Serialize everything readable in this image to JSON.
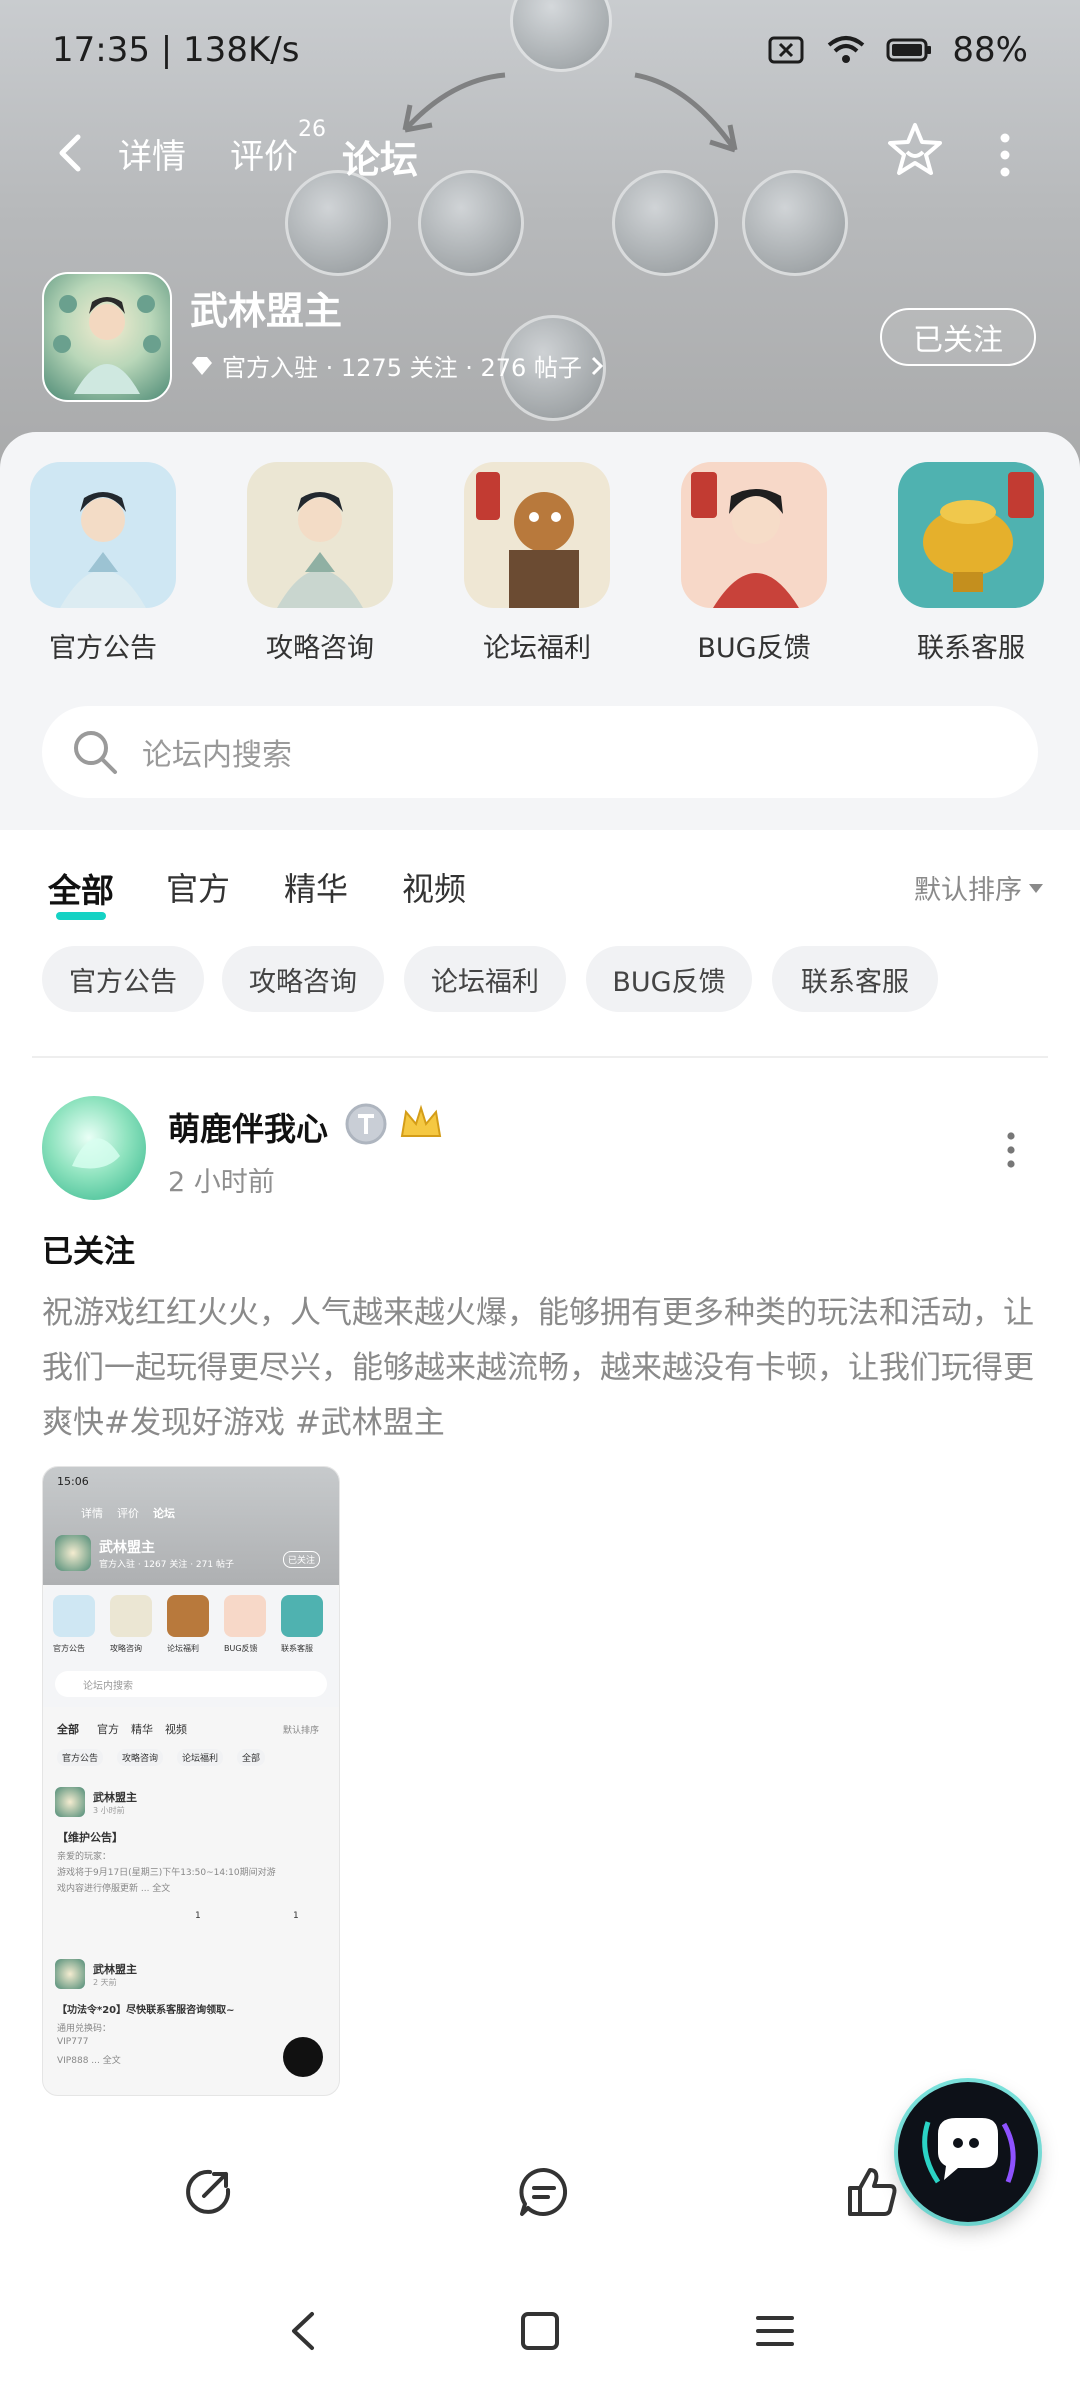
{
  "status_bar": {
    "time_speed": "17:35 | 138K/s",
    "battery": "88%"
  },
  "nav": {
    "tabs": [
      {
        "label": "详情"
      },
      {
        "label": "评价",
        "badge": "26"
      },
      {
        "label": "论坛"
      }
    ],
    "active_tab": "论坛"
  },
  "game": {
    "title": "武林盟主",
    "meta": "官方入驻 · 1275 关注 · 276 帖子",
    "follow_label": "已关注"
  },
  "categories": [
    {
      "label": "官方公告"
    },
    {
      "label": "攻略咨询"
    },
    {
      "label": "论坛福利"
    },
    {
      "label": "BUG反馈"
    },
    {
      "label": "联系客服"
    }
  ],
  "search": {
    "placeholder": "论坛内搜索"
  },
  "filter_tabs": [
    {
      "label": "全部"
    },
    {
      "label": "官方"
    },
    {
      "label": "精华"
    },
    {
      "label": "视频"
    }
  ],
  "sort_label": "默认排序",
  "chips": [
    {
      "label": "官方公告"
    },
    {
      "label": "攻略咨询"
    },
    {
      "label": "论坛福利"
    },
    {
      "label": "BUG反馈"
    },
    {
      "label": "联系客服"
    }
  ],
  "post": {
    "username": "萌鹿伴我心",
    "time": "2 小时前",
    "title": "已关注",
    "body": "祝游戏红红火火，人气越来越火爆，能够拥有更多种类的玩法和活动，让我们一起玩得更尽兴，能够越来越流畅，越来越没有卡顿，让我们玩得更爽快#发现好游戏 #武林盟主",
    "thumbnail": {
      "status_time": "15:06",
      "tabs": [
        "详情",
        "评价",
        "论坛"
      ],
      "game_title": "武林盟主",
      "meta": "官方入驻 · 1267 关注 · 271 帖子",
      "follow": "已关注",
      "categories": [
        "官方公告",
        "攻略咨询",
        "论坛福利",
        "BUG反馈",
        "联系客服"
      ],
      "search": "论坛内搜索",
      "filters": [
        "全部",
        "官方",
        "精华",
        "视频"
      ],
      "sort": "默认排序",
      "chips": [
        "官方公告",
        "攻略咨询",
        "论坛福利",
        "全部"
      ],
      "post1": {
        "author": "武林盟主",
        "time": "3 小时前",
        "title": "【维护公告】",
        "line1": "亲爱的玩家：",
        "line2": "游戏将于9月17日(星期三)下午13:50~14:10期间对游",
        "line3": "戏内容进行停服更新 ... 全文",
        "comments": "1",
        "likes": "1"
      },
      "post2": {
        "author": "武林盟主",
        "time": "2 天前",
        "title": "【功法令*20】尽快联系客服咨询领取~",
        "line1": "通用兑换码：",
        "line2": "VIP777",
        "line3": "VIP888 ... 全文"
      }
    }
  }
}
